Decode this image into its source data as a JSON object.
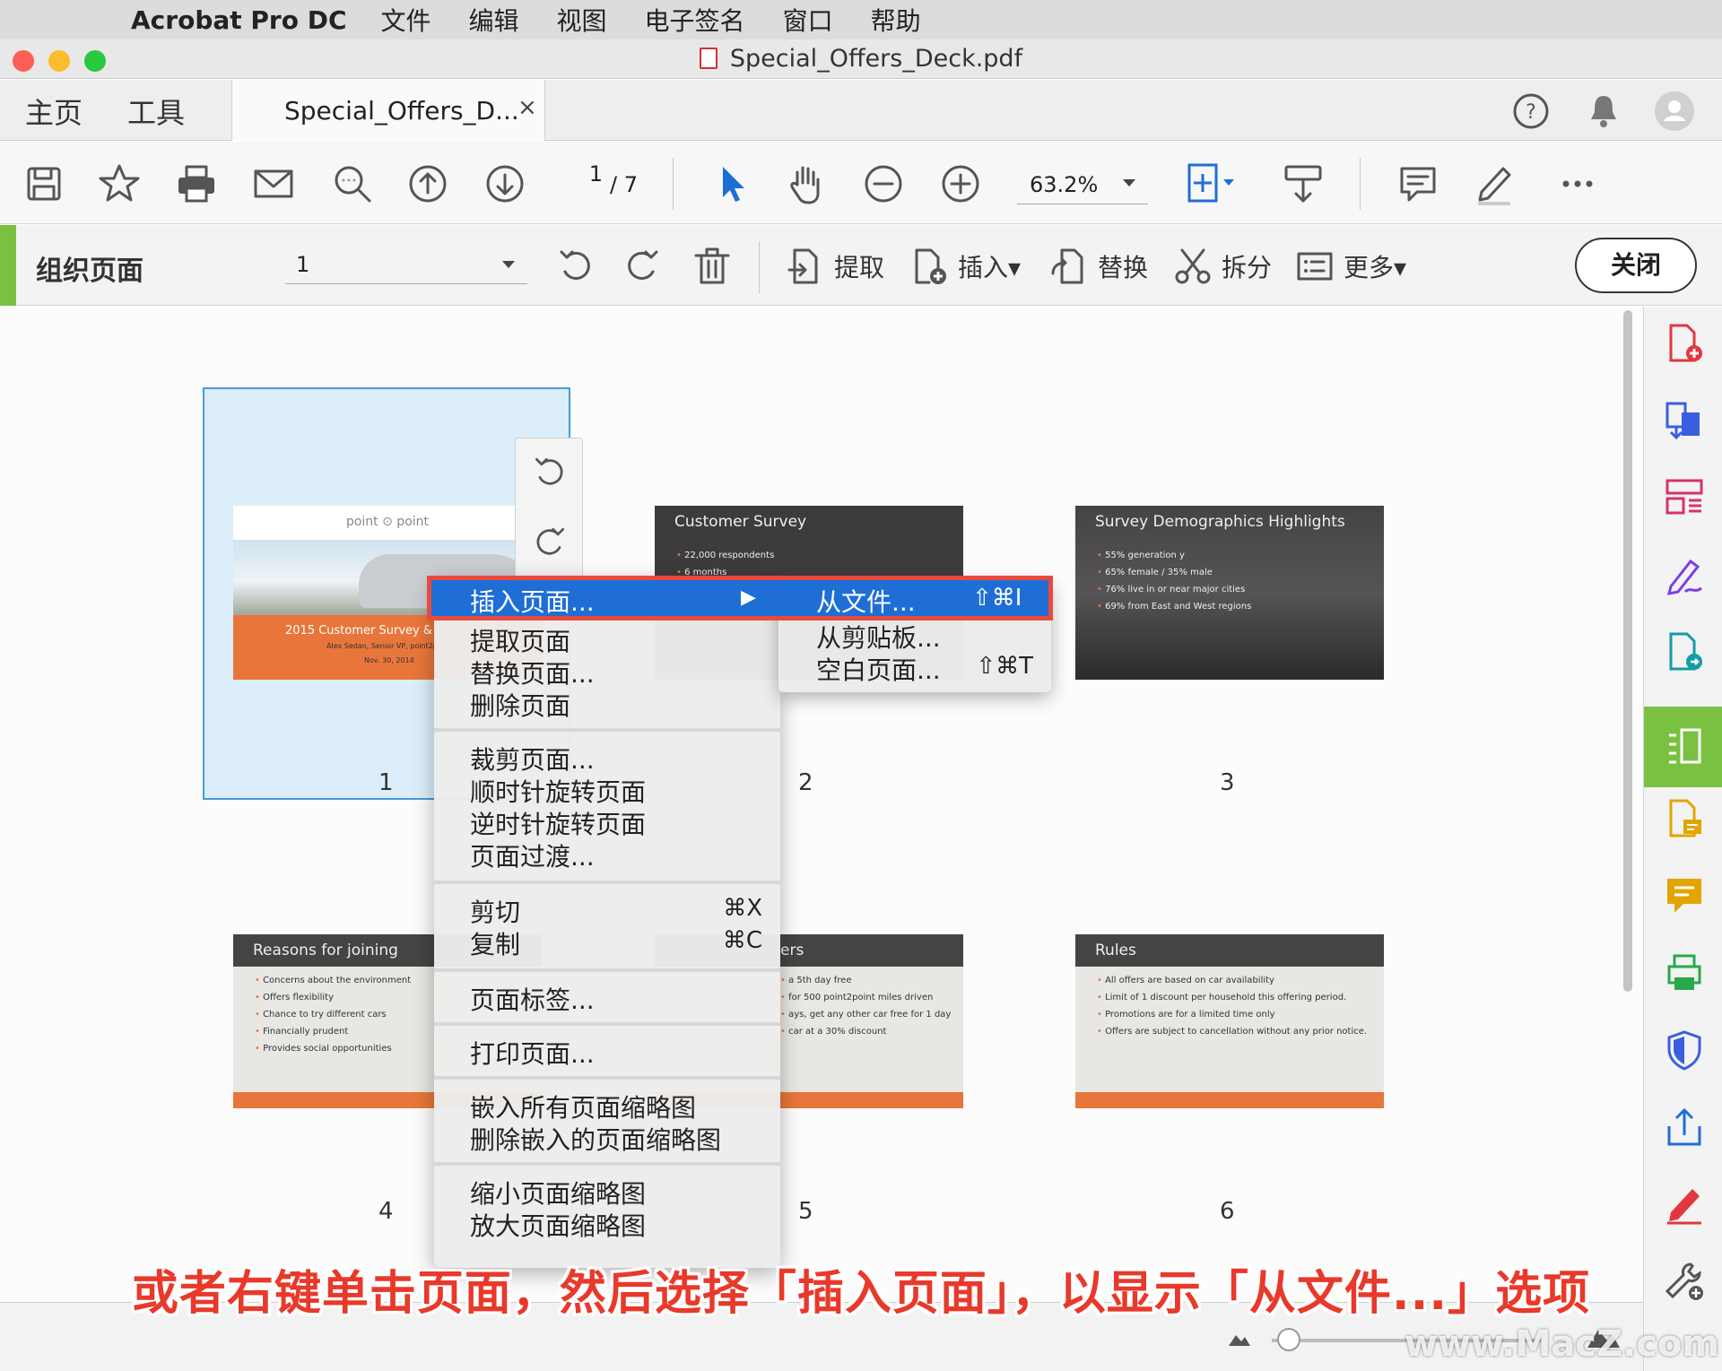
{
  "menubar": {
    "app_name": "Acrobat Pro DC",
    "items": [
      "文件",
      "编辑",
      "视图",
      "电子签名",
      "窗口",
      "帮助"
    ]
  },
  "window": {
    "title": "Special_Offers_Deck.pdf"
  },
  "tabs": {
    "home": "主页",
    "tools": "工具",
    "document": "Special_Offers_D...",
    "close_glyph": "×"
  },
  "toolbar": {
    "page_current": "1",
    "page_total": "/ 7",
    "zoom": "63.2%"
  },
  "organize": {
    "title": "组织页面",
    "page_select": "1",
    "extract": "提取",
    "insert": "插入▾",
    "replace": "替换",
    "split": "拆分",
    "more": "更多▾",
    "close": "关闭"
  },
  "pages": [
    {
      "number": "1",
      "logo": "point ⊙ point",
      "title": "2015 Customer Survey & Inc",
      "author": "Alex Sedan, Senior VP, point2p",
      "date": "Nov. 30, 2014"
    },
    {
      "number": "2",
      "title": "Customer Survey",
      "bullets": [
        "22,000 respondents",
        "6 months"
      ]
    },
    {
      "number": "3",
      "title": "Survey Demographics Highlights",
      "bullets": [
        "55% generation y",
        "65% female / 35% male",
        "76% live in or near major cities",
        "69% from East and West regions"
      ]
    },
    {
      "number": "4",
      "title": "Reasons for joining",
      "bullets": [
        "Concerns about the environment",
        "Offers flexibility",
        "Chance to try different cars",
        "Financially prudent",
        "Provides social opportunities"
      ]
    },
    {
      "number": "5",
      "title": "ers",
      "bullets": [
        "a 5th day free",
        "for 500 point2point miles driven",
        "ays, get any other car free for 1 day",
        "car at a 30% discount"
      ]
    },
    {
      "number": "6",
      "title": "Rules",
      "bullets": [
        "All offers are based on car availability",
        "Limit of 1 discount per household this offering period.",
        "Promotions are for a limited time only",
        "Offers are subject to cancellation without any prior notice."
      ]
    }
  ],
  "context_menu": {
    "insert_pages": "插入页面...",
    "extract_pages": "提取页面",
    "replace_pages": "替换页面...",
    "delete_pages": "删除页面",
    "crop_pages": "裁剪页面...",
    "rotate_cw": "顺时针旋转页面",
    "rotate_ccw": "逆时针旋转页面",
    "page_transitions": "页面过渡...",
    "cut": "剪切",
    "cut_shortcut": "⌘X",
    "copy": "复制",
    "copy_shortcut": "⌘C",
    "page_labels": "页面标签...",
    "print_pages": "打印页面...",
    "embed_thumbs": "嵌入所有页面缩略图",
    "remove_thumbs": "删除嵌入的页面缩略图",
    "shrink_thumbs": "缩小页面缩略图",
    "enlarge_thumbs": "放大页面缩略图",
    "arrow": "▶"
  },
  "submenu": {
    "from_file": "从文件...",
    "from_file_shortcut": "⇧⌘I",
    "from_clipboard": "从剪贴板...",
    "blank_page": "空白页面...",
    "blank_page_shortcut": "⇧⌘T"
  },
  "caption": "或者右键单击页面，然后选择「插入页面」，以显示「从文件...」选项",
  "watermark": "www.MacZ.com",
  "colors": {
    "accent_green": "#7ac142",
    "menu_highlight": "#1e6ed6",
    "annotation_red": "#e84a3c",
    "slide_orange": "#e8763a"
  }
}
